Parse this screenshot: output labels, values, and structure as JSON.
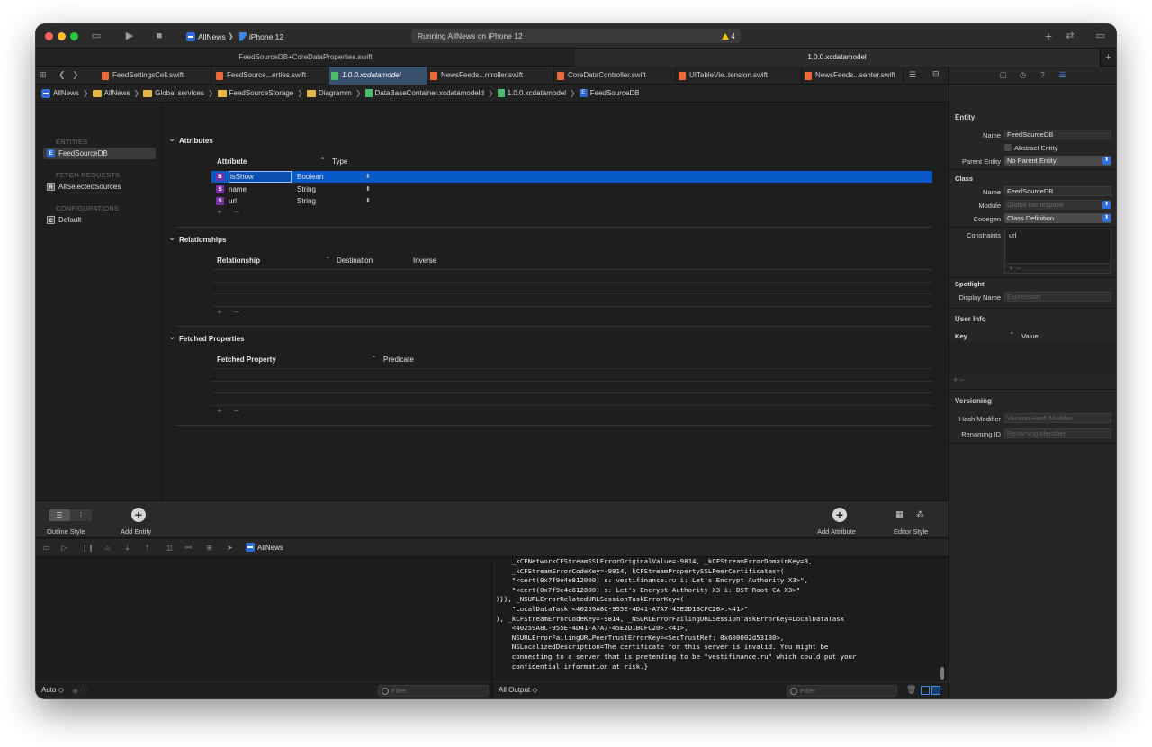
{
  "toolbar": {
    "scheme_app": "AllNews",
    "scheme_device": "iPhone 12",
    "status_text": "Running AllNews on iPhone 12",
    "warning_count": "4"
  },
  "doc_tabs": [
    {
      "label": "FeedSourceDB+CoreDataProperties.swift",
      "active": false
    },
    {
      "label": "1.0.0.xcdatamodel",
      "active": true
    }
  ],
  "file_tabs": [
    {
      "label": "FeedSettingsCell.swift",
      "kind": "swift"
    },
    {
      "label": "FeedSource...erties.swift",
      "kind": "swift"
    },
    {
      "label": "1.0.0.xcdatamodel",
      "kind": "model",
      "active": true
    },
    {
      "label": "NewsFeeds...ntroller.swift",
      "kind": "swift"
    },
    {
      "label": "CoreDataController.swift",
      "kind": "swift"
    },
    {
      "label": "UITableVie..tension.swift",
      "kind": "swift"
    },
    {
      "label": "NewsFeeds...senter.swift",
      "kind": "swift"
    }
  ],
  "breadcrumb": [
    "AllNews",
    "AllNews",
    "Global services",
    "FeedSourceStorage",
    "Diagramm",
    "DataBaseContainer.xcdatamodeld",
    "1.0.0.xcdatamodel",
    "FeedSourceDB"
  ],
  "outline": {
    "entities_header": "ENTITIES",
    "entities": [
      "FeedSourceDB"
    ],
    "fetch_header": "FETCH REQUESTS",
    "fetch_requests": [
      "AllSelectedSources"
    ],
    "config_header": "CONFIGURATIONS",
    "configurations": [
      "Default"
    ]
  },
  "editor": {
    "attributes_title": "Attributes",
    "attr_col_name": "Attribute",
    "attr_col_type": "Type",
    "attributes": [
      {
        "badge": "B",
        "name": "isShow",
        "type": "Boolean",
        "selected": true
      },
      {
        "badge": "S",
        "name": "name",
        "type": "String",
        "selected": false
      },
      {
        "badge": "S",
        "name": "url",
        "type": "String",
        "selected": false
      }
    ],
    "relationships_title": "Relationships",
    "rel_col_name": "Relationship",
    "rel_col_dest": "Destination",
    "rel_col_inverse": "Inverse",
    "fetched_title": "Fetched Properties",
    "fp_col_name": "Fetched Property",
    "fp_col_pred": "Predicate",
    "plus_minus": "+ −"
  },
  "editor_bar": {
    "outline_style": "Outline Style",
    "add_entity": "Add Entity",
    "add_attribute": "Add Attribute",
    "editor_style": "Editor Style"
  },
  "debug": {
    "app": "AllNews",
    "vars_select": "Auto ◇",
    "filter_placeholder": "Filter",
    "console_select": "All Output ◇",
    "console_lines": [
      "    _kCFNetworkCFStreamSSLErrorOriginalValue=-9814, _kCFStreamErrorDomainKey=3,",
      "    _kCFStreamErrorCodeKey=-9814, kCFStreamPropertySSLPeerCertificates=(",
      "    \"<cert(0x7f9e4e812000) s: vestifinance.ru i: Let's Encrypt Authority X3>\",",
      "    \"<cert(0x7f9e4e812800) s: Let's Encrypt Authority X3 i: DST Root CA X3>\"",
      ")}}, _NSURLErrorRelatedURLSessionTaskErrorKey=(",
      "    \"LocalDataTask <40259A8C-955E-4D41-A7A7-45E2D1BCFC20>.<41>\"",
      "), _kCFStreamErrorCodeKey=-9814, _NSURLErrorFailingURLSessionTaskErrorKey=LocalDataTask",
      "    <40259A8C-955E-4D41-A7A7-45E2D1BCFC20>.<41>,",
      "    NSURLErrorFailingURLPeerTrustErrorKey=<SecTrustRef: 0x600002d53180>,",
      "    NSLocalizedDescription=The certificate for this server is invalid. You might be",
      "    connecting to a server that is pretending to be \"vestifinance.ru\" which could put your",
      "    confidential information at risk.}"
    ]
  },
  "inspector": {
    "entity_title": "Entity",
    "name_label": "Name",
    "name_value": "FeedSourceDB",
    "abstract_label": "Abstract Entity",
    "parent_label": "Parent Entity",
    "parent_value": "No Parent Entity",
    "class_title": "Class",
    "class_name_label": "Name",
    "class_name_value": "FeedSourceDB",
    "module_label": "Module",
    "module_placeholder": "Global namespace",
    "codegen_label": "Codegen",
    "codegen_value": "Class Definition",
    "constraints_label": "Constraints",
    "constraints_value": "url",
    "spotlight_title": "Spotlight",
    "display_name_label": "Display Name",
    "display_name_placeholder": "Expression",
    "user_info_title": "User Info",
    "key_col": "Key",
    "value_col": "Value",
    "versioning_title": "Versioning",
    "hash_label": "Hash Modifier",
    "hash_placeholder": "Version Hash Modifier",
    "renaming_label": "Renaming ID",
    "renaming_placeholder": "Renaming Identifier"
  },
  "colors": {
    "selection": "#0a59c9",
    "accent": "#2f6ee0",
    "warning": "#f3c400"
  }
}
